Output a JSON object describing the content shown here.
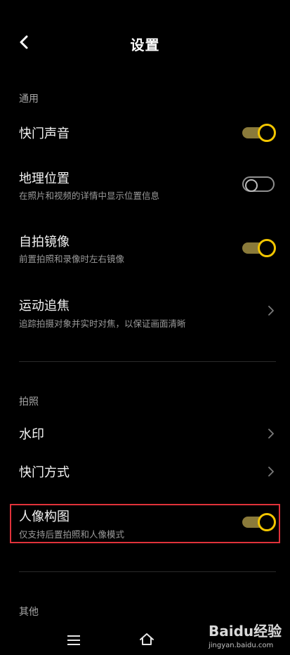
{
  "header": {
    "title": "设置"
  },
  "sections": {
    "general": "通用",
    "photo": "拍照",
    "other": "其他"
  },
  "rows": {
    "shutter_sound": {
      "title": "快门声音",
      "state": "on"
    },
    "location": {
      "title": "地理位置",
      "subtitle": "在照片和视频的详情中显示位置信息",
      "state": "off"
    },
    "selfie_mirror": {
      "title": "自拍镜像",
      "subtitle": "前置拍照和录像时左右镜像",
      "state": "on"
    },
    "motion_tracking": {
      "title": "运动追焦",
      "subtitle": "追踪拍摄对象并实时对焦，以保证画面清晰"
    },
    "watermark": {
      "title": "水印"
    },
    "shutter_mode": {
      "title": "快门方式"
    },
    "portrait_composition": {
      "title": "人像构图",
      "subtitle": "仅支持后置拍照和人像模式",
      "state": "on"
    }
  },
  "colors": {
    "toggle_on_knob": "#f3c600",
    "toggle_on_track": "#8a7a3a",
    "highlight": "#e0323a"
  },
  "watermark_logo": {
    "brand": "Baidu经验",
    "url": "jingyan.baidu.com"
  },
  "icons": {
    "back": "chevron-left-icon",
    "chevron": "chevron-right-icon",
    "menu": "menu-icon",
    "home": "home-icon"
  }
}
